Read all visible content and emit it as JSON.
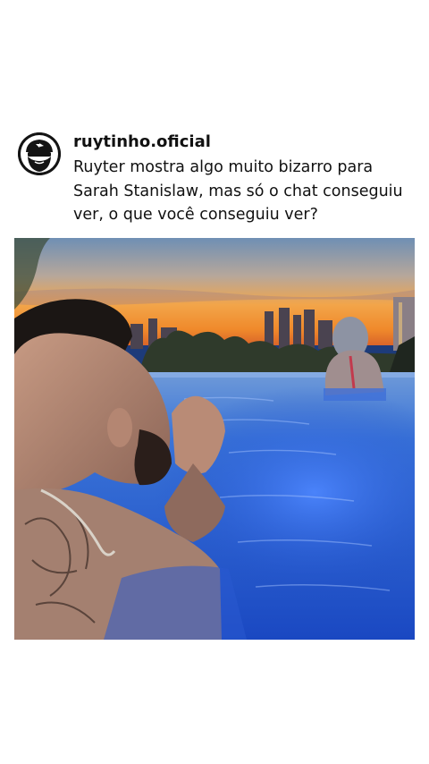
{
  "post": {
    "username": "ruytinho.oficial",
    "caption": "Ruyter mostra algo muito bizarro para Sarah Stanislaw, mas só o chat conseguiu ver, o que você conseguiu ver?",
    "avatar_icon": "bearded-sunglasses-face-logo",
    "media": "photo-pool-sunset"
  },
  "colors": {
    "background": "#ffffff",
    "text": "#111111",
    "sky_top": "#6b8fb8",
    "sunset": "#f39a2a",
    "water": "#1f55c9"
  }
}
